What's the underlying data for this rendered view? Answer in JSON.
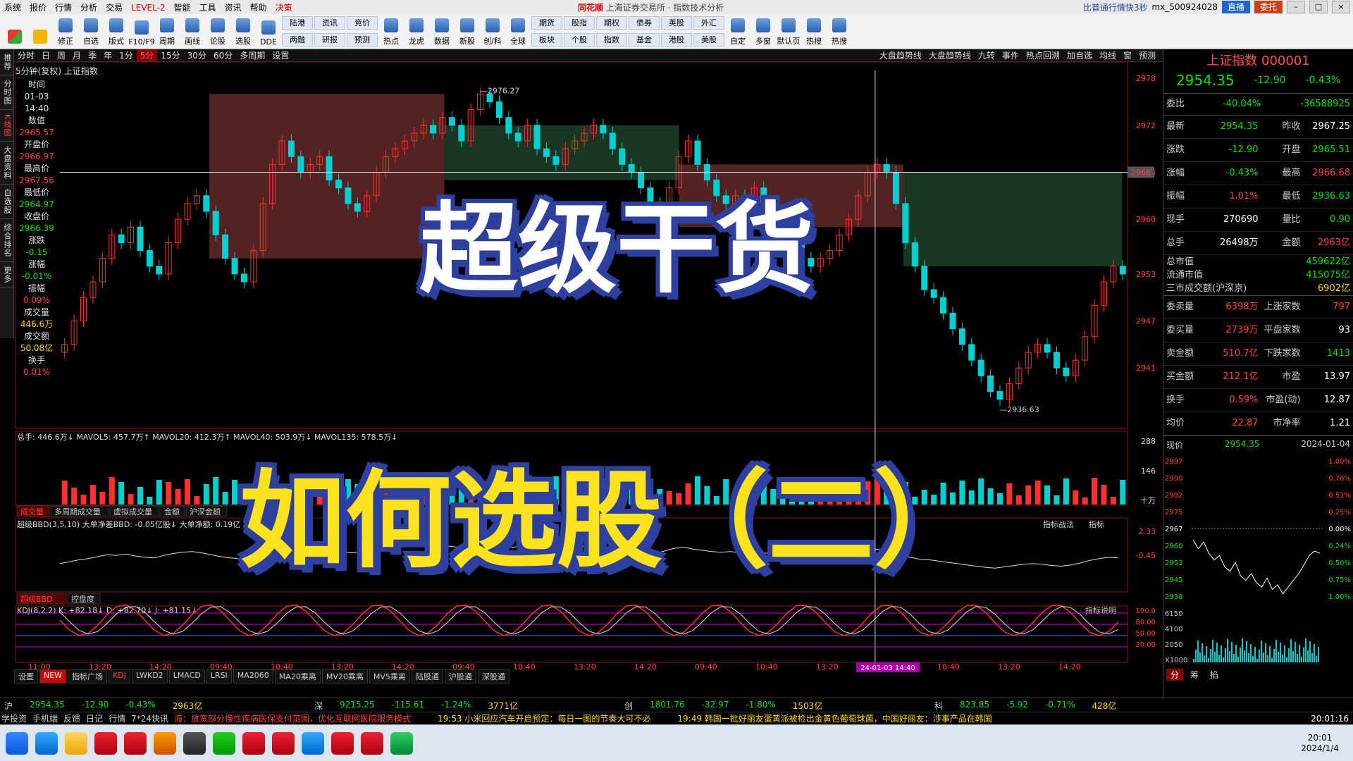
{
  "menu": {
    "items": [
      "系统",
      "报价",
      "行情",
      "分析",
      "交易",
      "LEVEL-2",
      "智能",
      "工具",
      "资讯",
      "帮助",
      "决策"
    ],
    "brand": "同花顺",
    "title": "上海证券交易所 · 指数技术分析",
    "right_info": "比普通行情快3秒",
    "account": "mx_500924028",
    "btn_live": "直播",
    "btn_entrust": "委托"
  },
  "toolbar": {
    "single": [
      "修正",
      "自选",
      "版式",
      "F10/F9",
      "周期",
      "画线",
      "论股",
      "选股",
      "DDE"
    ],
    "pairs": [
      [
        "陆港",
        "两融"
      ],
      [
        "资讯",
        "研报"
      ],
      [
        "竞价",
        "预测"
      ]
    ],
    "single2": [
      "热点",
      "龙虎",
      "数据",
      "新股",
      "创/科",
      "全球"
    ],
    "pairs2": [
      [
        "期货",
        "板块"
      ],
      [
        "股指",
        "个股"
      ],
      [
        "期权",
        "指数"
      ],
      [
        "债券",
        "基金"
      ],
      [
        "英股",
        "港股"
      ],
      [
        "外汇",
        "美股"
      ]
    ],
    "single3": [
      "自定",
      "多窗",
      "默认页",
      "热搜",
      "热搜"
    ]
  },
  "lefttabs": [
    "推荐",
    "分时图",
    "K线图",
    "大盘资料",
    "自选股",
    "综合排名",
    "更多"
  ],
  "period": {
    "items": [
      "分时",
      "日",
      "周",
      "月",
      "季",
      "年",
      "1分",
      "5分",
      "15分",
      "30分",
      "60分",
      "多周期",
      "设置"
    ],
    "active": "5分",
    "right": [
      "大盘趋势线",
      "大盘趋势线",
      "九转",
      "事件",
      "热点回溯",
      "加自选",
      "均线",
      "窗",
      "预测"
    ]
  },
  "chart_title": "5分钟(复权)  上证指数",
  "info": {
    "time_label": "时间",
    "date": "01-03",
    "time": "14:40",
    "value_label": "数值",
    "v1": "2965.57",
    "open_label": "开盘价",
    "open": "2966.97",
    "high_label": "最高价",
    "high": "2967.56",
    "low_label": "最低价",
    "low": "2964.97",
    "close_label": "收盘价",
    "close": "2966.39",
    "chg_label": "涨跌",
    "chg": "-0.15",
    "chgpct_label": "涨幅",
    "chgpct": "-0.01%",
    "amp_label": "振幅",
    "amp": "0.09%",
    "vol_label": "成交量",
    "vol": "446.6万",
    "amt_label": "成交额",
    "amt": "50.08亿",
    "turn_label": "换手",
    "turn": "0.01%"
  },
  "chart_data": {
    "type": "candlestick",
    "ylim": [
      2934,
      2979
    ],
    "yticks": [
      "2978",
      "2972",
      "2966",
      "2960",
      "2953",
      "2947",
      "2941"
    ],
    "max_label": "2976.27",
    "min_label": "2936.63",
    "cross_price": "2966",
    "xticks": [
      "11:00",
      "13:20",
      "14:20",
      "09:40",
      "10:40",
      "13:20",
      "14:20",
      "09:40",
      "10:40",
      "13:20",
      "14:20",
      "09:40",
      "10:40",
      "13:20",
      "14:20",
      "10:40",
      "13:20",
      "14:20"
    ],
    "cursor_label": "24-01-03 14:40",
    "close_series": [
      2944,
      2947,
      2950,
      2952,
      2955,
      2958,
      2957,
      2959,
      2956,
      2954,
      2953,
      2957,
      2960,
      2962,
      2963,
      2961,
      2958,
      2955,
      2953,
      2952,
      2956,
      2962,
      2967,
      2970,
      2968,
      2966,
      2967,
      2968,
      2965,
      2964,
      2962,
      2961,
      2963,
      2966,
      2968,
      2969,
      2970,
      2971,
      2972,
      2971,
      2973,
      2972,
      2970,
      2974,
      2976,
      2975,
      2973,
      2971,
      2970,
      2972,
      2969,
      2968,
      2967,
      2969,
      2970,
      2971,
      2972,
      2971,
      2969,
      2967,
      2966,
      2964,
      2962,
      2960,
      2964,
      2968,
      2970,
      2967,
      2965,
      2963,
      2962,
      2963,
      2961,
      2964,
      2962,
      2960,
      2958,
      2957,
      2955,
      2954,
      2955,
      2956,
      2958,
      2960,
      2963,
      2966,
      2967,
      2966,
      2962,
      2957,
      2954,
      2951,
      2950,
      2948,
      2946,
      2944,
      2942,
      2940,
      2938,
      2937,
      2939,
      2941,
      2943,
      2944,
      2943,
      2941,
      2940,
      2942,
      2945,
      2949,
      2952,
      2954,
      2953
    ],
    "volume_label": "总手: 446.6万↓ MAVOL5: 457.7万↑ MAVOL20: 412.3万↑ MAVOL40: 503.9万↓ MAVOL135: 578.5万↓",
    "vol_ticks": [
      "288",
      "146",
      "十万"
    ],
    "bbd_label": "超级BBD(3,5,10) 大单净差BBD: -0.05亿股↓ 大单净额: 0.19亿",
    "bbd_ticks": [
      "2.33",
      "-0.45"
    ],
    "kdj_label": "KDJ(8,2,2) K: +82.18↓ D: +82.70↓ J: +81.15↓",
    "kdj_ticks": [
      "100.0",
      "80.00",
      "50.00",
      "20.00"
    ],
    "zones": [
      {
        "from": 2955,
        "to": 2976,
        "color": "#8b3a3a",
        "x0_frac": 0.14,
        "x1_frac": 0.36
      },
      {
        "from": 2965,
        "to": 2972,
        "color": "#2a5a3a",
        "x0_frac": 0.36,
        "x1_frac": 0.58
      },
      {
        "from": 2959,
        "to": 2967,
        "color": "#8b3a3a",
        "x0_frac": 0.58,
        "x1_frac": 0.79
      },
      {
        "from": 2954,
        "to": 2966,
        "color": "#2a5a3a",
        "x0_frac": 0.79,
        "x1_frac": 0.995
      }
    ]
  },
  "indicator_tabs": [
    "成交量",
    "多周期成交量",
    "虚拟成交量",
    "金额",
    "沪深金额"
  ],
  "indicator_tabs2": [
    "超级BBD",
    "控盘度"
  ],
  "bottom_tabs": [
    "设置",
    "指标广场",
    "KDJ",
    "LWKD2",
    "LMACD",
    "LRSI",
    "MA2060",
    "MA20乘离",
    "MV20乘离",
    "MV5乘离",
    "陆股通",
    "沪股通",
    "深股通"
  ],
  "bottom_tab_active": "KDJ",
  "tag_new": "NEW",
  "side_btn1": "指标战法",
  "side_btn2": "指标",
  "side_btn3": "指标说明",
  "overlay": {
    "line1": "超级干货",
    "line2": "如何选股（二）"
  },
  "right": {
    "name": "上证指数 000001",
    "price": "2954.35",
    "chg": "-12.90",
    "pct": "-0.43%",
    "weibi_label": "委比",
    "weibi": "-40.04%",
    "weicha": "-36588925",
    "rows": [
      [
        "最新",
        "2954.35",
        "昨收",
        "2967.25"
      ],
      [
        "涨跌",
        "-12.90",
        "开盘",
        "2965.51"
      ],
      [
        "涨幅",
        "-0.43%",
        "最高",
        "2966.68"
      ],
      [
        "振幅",
        "1.01%",
        "最低",
        "2936.63"
      ],
      [
        "现手",
        "270690",
        "量比",
        "0.90"
      ],
      [
        "总手",
        "26498万",
        "金额",
        "2963亿"
      ]
    ],
    "mc": [
      [
        "总市值",
        "459622亿"
      ],
      [
        "流通市值",
        "415075亿"
      ]
    ],
    "mc3": [
      "三市成交额(沪深京)",
      "6902亿"
    ],
    "rows2": [
      [
        "委卖量",
        "6398万",
        "上涨家数",
        "797"
      ],
      [
        "委买量",
        "2739万",
        "平盘家数",
        "93"
      ],
      [
        "卖金额",
        "510.7亿",
        "下跌家数",
        "1413"
      ],
      [
        "买金额",
        "212.1亿",
        "市盈",
        "13.97"
      ],
      [
        "换手",
        "0.59%",
        "市盈(动)",
        "12.87"
      ],
      [
        "均价",
        "22.87",
        "市净率",
        "1.21"
      ]
    ],
    "mini_label": "现价",
    "mini_price": "2954.35",
    "mini_date": "2024-01-04",
    "mini_yticks": [
      "2997",
      "2990",
      "2982",
      "2975",
      "2967",
      "2960",
      "2953",
      "2945",
      "2938"
    ],
    "mini_pct": [
      "1.00%",
      "0.76%",
      "0.51%",
      "0.25%",
      "0.00%",
      "0.24%",
      "0.50%",
      "0.75%",
      "1.00%"
    ],
    "mini_vol": [
      "6150",
      "4100",
      "2050",
      "X1000"
    ],
    "mini_series": [
      2962,
      2958,
      2961,
      2956,
      2953,
      2955,
      2950,
      2948,
      2952,
      2946,
      2944,
      2947,
      2943,
      2941,
      2945,
      2940,
      2942,
      2938,
      2941,
      2944,
      2947,
      2951,
      2955,
      2957,
      2956
    ],
    "bottom_tabs": [
      "分",
      "筹",
      "掐"
    ]
  },
  "indexbar": [
    [
      "沪",
      "2954.35",
      "-12.90",
      "-0.43%",
      "2963亿"
    ],
    [
      "深",
      "9215.25",
      "-115.61",
      "-1.24%",
      "3771亿"
    ],
    [
      "创",
      "1801.76",
      "-32.97",
      "-1.80%",
      "1503亿"
    ],
    [
      "科",
      "823.85",
      "-5.92",
      "-0.71%",
      "428亿"
    ]
  ],
  "status": {
    "items": [
      "学投资",
      "手机端",
      "反馈",
      "日记",
      "行情",
      "7*24快讯"
    ],
    "ticker1": "海：放宽部分慢性疾病医保支付范围，优化互联网医院服务模式",
    "ticker2": "19:53 小米回应汽车开启预定：每日一图的节奏大可不必",
    "ticker3": "19:49 韩国一批好丽友蛋黄派被检出金黄色葡萄球菌，中国好丽友：涉事产品在韩国",
    "time": "20:01:16"
  },
  "taskbar": {
    "time": "20:01",
    "date": "2024/1/4"
  }
}
